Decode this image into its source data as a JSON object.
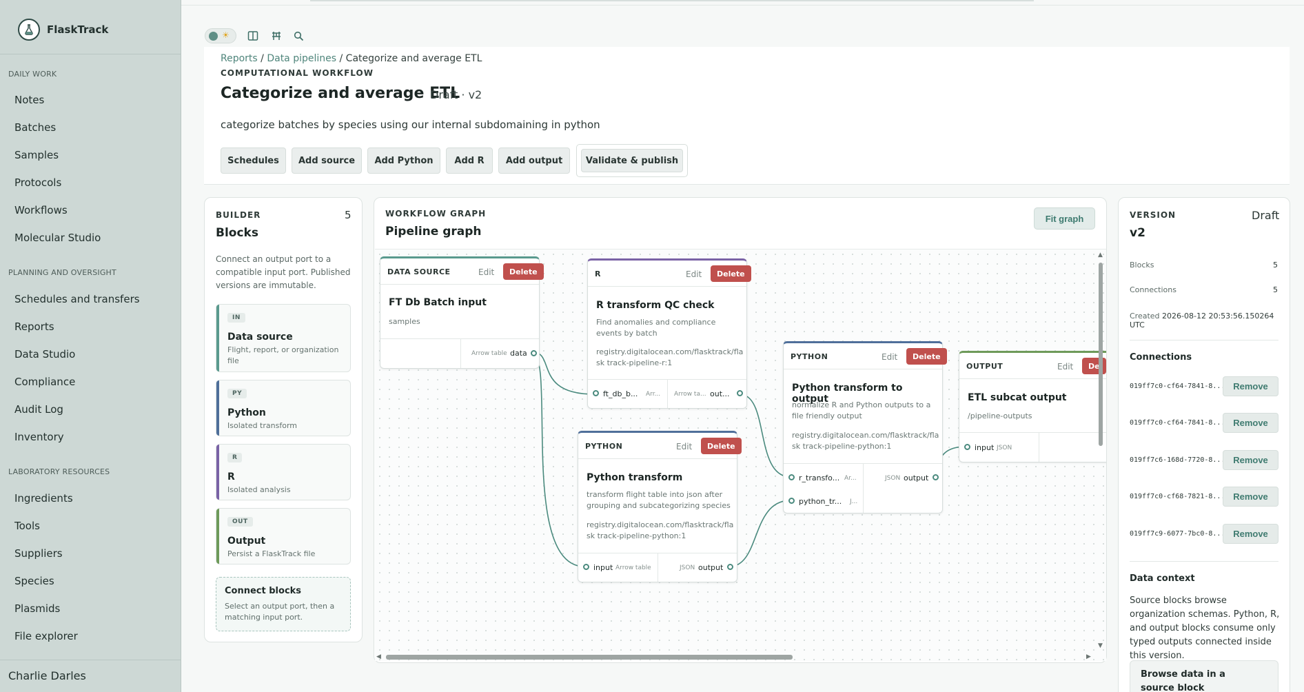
{
  "app": {
    "name": "FlaskTrack"
  },
  "sidebar": {
    "sections": [
      {
        "title": "DAILY WORK",
        "items": [
          "Notes",
          "Batches",
          "Samples",
          "Protocols",
          "Workflows",
          "Molecular Studio"
        ]
      },
      {
        "title": "PLANNING AND OVERSIGHT",
        "items": [
          "Schedules and transfers",
          "Reports",
          "Data Studio",
          "Compliance",
          "Audit Log",
          "Inventory"
        ]
      },
      {
        "title": "LABORATORY RESOURCES",
        "items": [
          "Ingredients",
          "Tools",
          "Suppliers",
          "Species",
          "Plasmids",
          "File explorer"
        ]
      }
    ],
    "user": "Charlie Darles"
  },
  "header": {
    "breadcrumb": [
      "Reports",
      "Data pipelines",
      "Categorize and average ETL"
    ],
    "eyebrow": "COMPUTATIONAL WORKFLOW",
    "title": "Categorize and average ETL",
    "status": "Draft · v2",
    "description": "categorize batches by species using our internal subdomaining in python",
    "actions": [
      "Schedules",
      "Add source",
      "Add Python",
      "Add R",
      "Add output"
    ],
    "publish": "Validate & publish"
  },
  "builder": {
    "eyebrow": "BUILDER",
    "title": "Blocks",
    "count": "5",
    "help": "Connect an output port to a compatible input port. Published versions are immutable.",
    "palette": [
      {
        "tag": "IN",
        "name": "Data source",
        "desc": "Flight, report, or organization file",
        "color": "#5a9a8e"
      },
      {
        "tag": "PY",
        "name": "Python",
        "desc": "Isolated transform",
        "color": "#4f6f9a"
      },
      {
        "tag": "R",
        "name": "R",
        "desc": "Isolated analysis",
        "color": "#7a62a6"
      },
      {
        "tag": "OUT",
        "name": "Output",
        "desc": "Persist a FlaskTrack file",
        "color": "#6e9a5a"
      }
    ],
    "connect": {
      "title": "Connect blocks",
      "desc": "Select an output port, then a matching input port."
    }
  },
  "graph": {
    "eyebrow": "WORKFLOW GRAPH",
    "title": "Pipeline graph",
    "fit": "Fit graph",
    "edit": "Edit",
    "delete": "Delete",
    "nodes": {
      "source": {
        "kind": "DATA SOURCE",
        "name": "FT Db Batch input",
        "desc": "samples",
        "out_type": "Arrow table",
        "out_label": "data"
      },
      "rqc": {
        "kind": "R",
        "name": "R transform QC check",
        "desc": "Find anomalies and compliance events by batch",
        "image": "registry.digitalocean.com/flasktrack/flask track-pipeline-r:1",
        "in_label": "ft_db_b...",
        "in_type": "Arr...",
        "out_type": "Arrow ta...",
        "out_label": "out..."
      },
      "py1": {
        "kind": "PYTHON",
        "name": "Python transform",
        "desc": "transform flight table into json after grouping and subcategorizing species",
        "image": "registry.digitalocean.com/flasktrack/flask track-pipeline-python:1",
        "in_label": "input",
        "in_type": "Arrow table",
        "out_type": "JSON",
        "out_label": "output"
      },
      "py2": {
        "kind": "PYTHON",
        "name": "Python transform to output",
        "desc": "normalize R and Python outputs to a file friendly output",
        "image": "registry.digitalocean.com/flasktrack/flask track-pipeline-python:1",
        "in1_label": "r_transfo...",
        "in1_type": "Ar...",
        "in2_label": "python_tr...",
        "in2_type": "J...",
        "out_type": "JSON",
        "out_label": "output"
      },
      "out": {
        "kind": "OUTPUT",
        "name": "ETL subcat output",
        "desc": "/pipeline-outputs",
        "in_label": "input",
        "in_type": "JSON",
        "delete_partial": "De"
      }
    },
    "colors": {
      "source": "#5a9a8e",
      "r": "#7a62a6",
      "python": "#4f6f9a",
      "output": "#6e9a5a",
      "edge": "#4a8a7e"
    }
  },
  "version": {
    "eyebrow": "VERSION",
    "state": "Draft",
    "name": "v2",
    "stats": {
      "blocks_label": "Blocks",
      "blocks": "5",
      "connections_label": "Connections",
      "connections": "5"
    },
    "created_label": "Created",
    "created": "2026-08-12 20:53:56.150264 UTC",
    "connections_title": "Connections",
    "connections": [
      "019ff7c0-cf64-7841-8...",
      "019ff7c0-cf64-7841-8...",
      "019ff7c6-168d-7720-8...",
      "019ff7c0-cf68-7821-8...",
      "019ff7c9-6077-7bc0-8..."
    ],
    "remove": "Remove",
    "data_context_title": "Data context",
    "data_context": "Source blocks browse organization schemas. Python, R, and output blocks consume only typed outputs connected inside this version.",
    "browse": "Browse data in a source block"
  }
}
